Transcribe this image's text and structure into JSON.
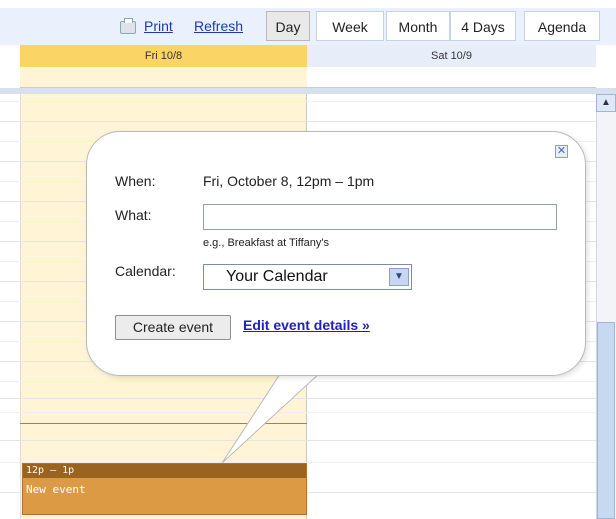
{
  "toolbar": {
    "print_label": "Print",
    "refresh_label": "Refresh",
    "views": [
      "Day",
      "Week",
      "Month",
      "4 Days",
      "Agenda"
    ]
  },
  "days": {
    "fri": "Fri 10/8",
    "sat": "Sat 10/9"
  },
  "event": {
    "time": "12p – 1p",
    "title": "New event"
  },
  "bubble": {
    "when_label": "When:",
    "when_value": "Fri, October 8, 12pm – 1pm",
    "what_label": "What:",
    "what_value": "",
    "what_hint": "e.g., Breakfast at Tiffany's",
    "calendar_label": "Calendar:",
    "calendar_value": "Your Calendar",
    "create_label": "Create event",
    "edit_label": "Edit event details »"
  },
  "colors": {
    "today_header": "#fbd466",
    "today_column": "#fff5d6",
    "event_fill": "#dc9a45",
    "event_header": "#9a6320",
    "link": "#1a3caa"
  },
  "icons": {
    "print": "printer-icon",
    "close": "close-icon",
    "dropdown": "chevron-down-icon",
    "scroll_up": "chevron-up-icon"
  }
}
